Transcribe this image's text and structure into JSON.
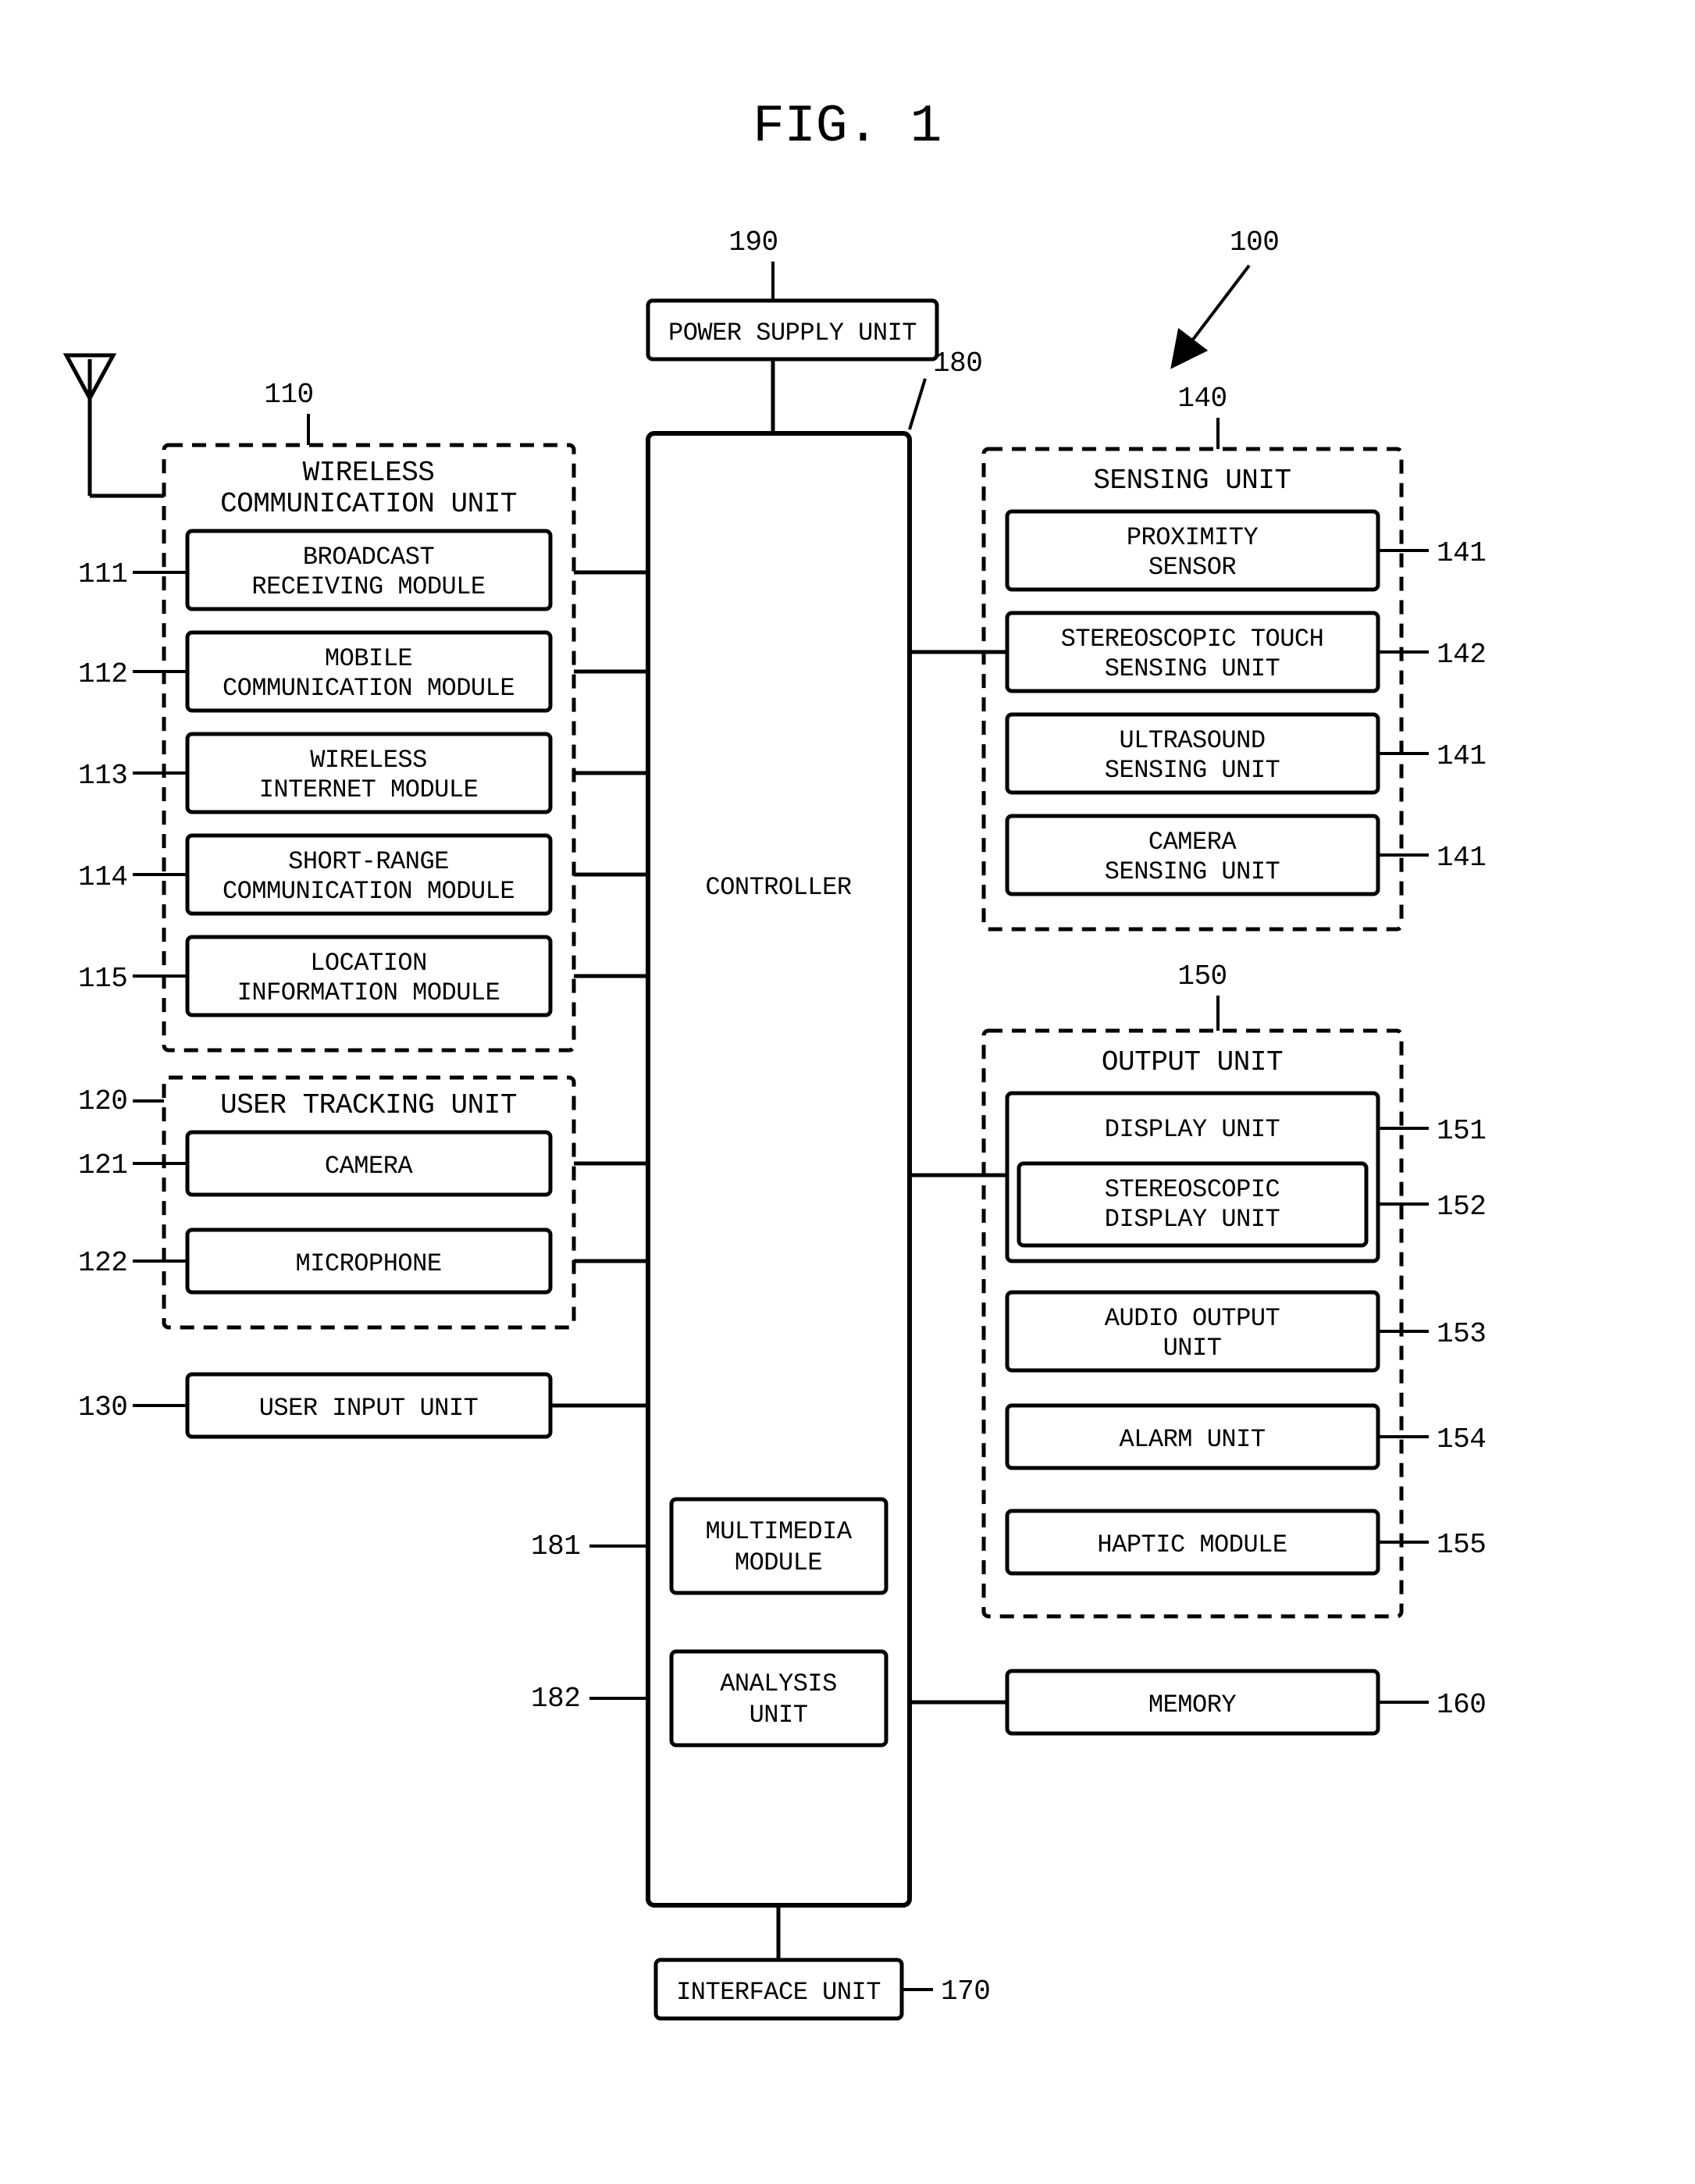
{
  "figure_label": "FIG. 1",
  "refs": {
    "r100": "100",
    "r190": "190",
    "r180": "180",
    "r110": "110",
    "r111": "111",
    "r112": "112",
    "r113": "113",
    "r114": "114",
    "r115": "115",
    "r120": "120",
    "r121": "121",
    "r122": "122",
    "r130": "130",
    "r181": "181",
    "r182": "182",
    "r170": "170",
    "r140": "140",
    "r141a": "141",
    "r142": "142",
    "r141b": "141",
    "r141c": "141",
    "r150": "150",
    "r151": "151",
    "r152": "152",
    "r153": "153",
    "r154": "154",
    "r155": "155",
    "r160": "160"
  },
  "labels": {
    "power_supply": "POWER SUPPLY UNIT",
    "controller": "CONTROLLER",
    "wireless_unit_1": "WIRELESS",
    "wireless_unit_2": "COMMUNICATION UNIT",
    "broadcast_1": "BROADCAST",
    "broadcast_2": "RECEIVING MODULE",
    "mobile_1": "MOBILE",
    "mobile_2": "COMMUNICATION MODULE",
    "winternet_1": "WIRELESS",
    "winternet_2": "INTERNET MODULE",
    "short_1": "SHORT-RANGE",
    "short_2": "COMMUNICATION MODULE",
    "location_1": "LOCATION",
    "location_2": "INFORMATION MODULE",
    "user_tracking": "USER TRACKING UNIT",
    "camera": "CAMERA",
    "microphone": "MICROPHONE",
    "user_input": "USER INPUT UNIT",
    "multimedia_1": "MULTIMEDIA",
    "multimedia_2": "MODULE",
    "analysis_1": "ANALYSIS",
    "analysis_2": "UNIT",
    "interface": "INTERFACE UNIT",
    "sensing": "SENSING UNIT",
    "proximity_1": "PROXIMITY",
    "proximity_2": "SENSOR",
    "stereo_touch_1": "STEREOSCOPIC TOUCH",
    "stereo_touch_2": "SENSING UNIT",
    "ultrasound_1": "ULTRASOUND",
    "ultrasound_2": "SENSING UNIT",
    "cam_sense_1": "CAMERA",
    "cam_sense_2": "SENSING UNIT",
    "output": "OUTPUT UNIT",
    "display": "DISPLAY UNIT",
    "stereo_disp_1": "STEREOSCOPIC",
    "stereo_disp_2": "DISPLAY UNIT",
    "audio_1": "AUDIO OUTPUT",
    "audio_2": "UNIT",
    "alarm": "ALARM UNIT",
    "haptic": "HAPTIC MODULE",
    "memory": "MEMORY"
  }
}
